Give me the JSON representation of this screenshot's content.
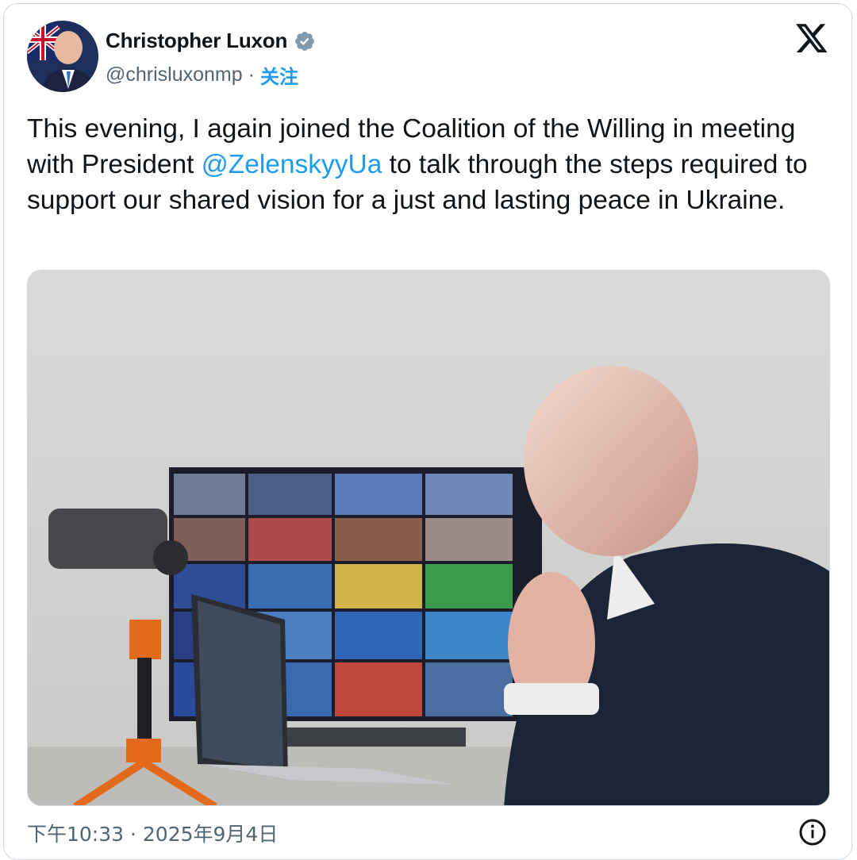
{
  "author": {
    "name": "Christopher Luxon",
    "handle": "@chrisluxonmp",
    "separator": "·",
    "follow_label": "关注",
    "verified": true
  },
  "tweet": {
    "text_before_mention": "This evening, I again joined the Coalition of the Willing in meeting with President ",
    "mention": "@ZelenskyyUa",
    "text_after_mention": " to talk through the steps required to support our shared vision for a just and lasting peace in Ukraine.",
    "timestamp": "下午10:33 · 2025年9月4日"
  },
  "icons": {
    "verified": "verified-badge-icon",
    "brand": "x-logo-icon",
    "info": "info-icon"
  },
  "colors": {
    "accent": "#1d9bf0",
    "text": "#0f1419",
    "secondary": "#536471",
    "border": "#cfd9de"
  }
}
